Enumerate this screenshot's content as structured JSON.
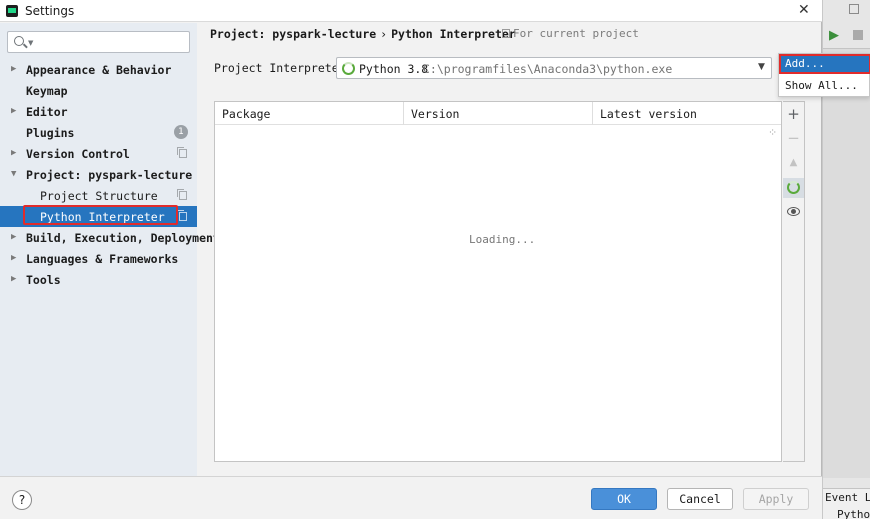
{
  "window": {
    "title": "Settings"
  },
  "search": {
    "placeholder": ""
  },
  "sidebar": {
    "items": [
      {
        "label": "Appearance & Behavior",
        "arrow": "▶"
      },
      {
        "label": "Keymap"
      },
      {
        "label": "Editor",
        "arrow": "▶"
      },
      {
        "label": "Plugins",
        "badge": "1"
      },
      {
        "label": "Version Control",
        "arrow": "▶"
      },
      {
        "label": "Project: pyspark-lecture",
        "arrow": "▼"
      },
      {
        "label": "Project Structure"
      },
      {
        "label": "Python Interpreter"
      },
      {
        "label": "Build, Execution, Deployment",
        "arrow": "▶"
      },
      {
        "label": "Languages & Frameworks",
        "arrow": "▶"
      },
      {
        "label": "Tools",
        "arrow": "▶"
      }
    ]
  },
  "breadcrumb": {
    "project": "Project: pyspark-lecture",
    "separator": "›",
    "page": "Python Interpreter"
  },
  "scope_label": "For current project",
  "interpreter": {
    "label": "Project Interpreter:",
    "name": "Python 3.8",
    "path": "C:\\programfiles\\Anaconda3\\python.exe"
  },
  "gear_menu": {
    "add": "Add...",
    "show_all": "Show All..."
  },
  "packages": {
    "columns": [
      "Package",
      "Version",
      "Latest version"
    ],
    "status": "Loading..."
  },
  "toolbar": {
    "add": "+",
    "remove": "−",
    "upgrade": "▲"
  },
  "footer": {
    "help": "?",
    "ok": "OK",
    "cancel": "Cancel",
    "apply": "Apply"
  },
  "ide": {
    "event_log": "Event Lo",
    "python_tab": "Python"
  },
  "colors": {
    "accent": "#2675bf",
    "highlight": "#e12b2b",
    "spinner": "#5aaa3c"
  }
}
